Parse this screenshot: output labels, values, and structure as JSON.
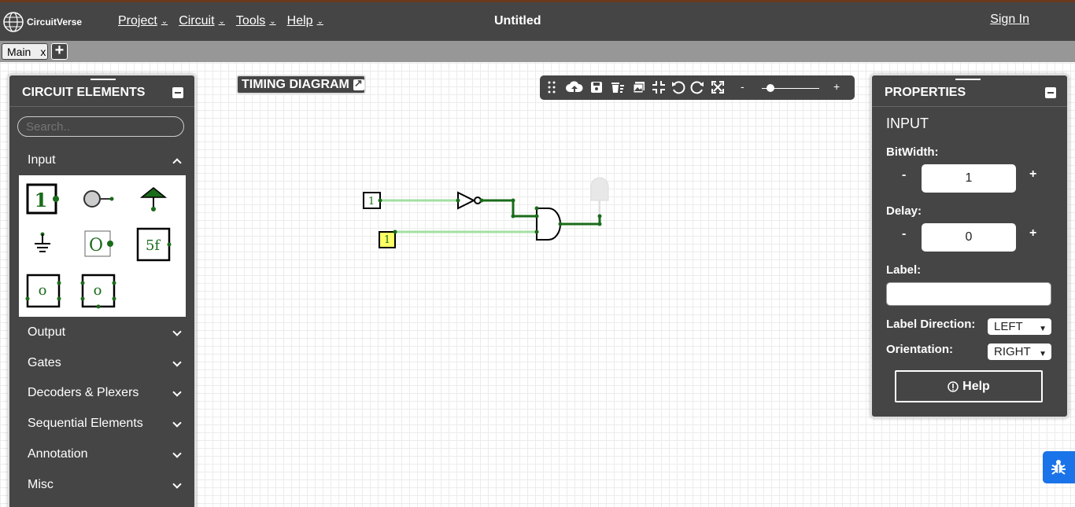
{
  "app": {
    "logo_name": "CircuitVerse",
    "title": "Untitled",
    "sign_in": "Sign In"
  },
  "nav": {
    "items": [
      "Project",
      "Circuit",
      "Tools",
      "Help"
    ]
  },
  "tabs": {
    "main_label": "Main",
    "close": "x",
    "add": "+"
  },
  "elements_panel": {
    "title": "CIRCUIT ELEMENTS",
    "search_placeholder": "Search..",
    "categories": [
      "Input",
      "Output",
      "Gates",
      "Decoders & Plexers",
      "Sequential Elements",
      "Annotation",
      "Misc"
    ],
    "input_icons": [
      "input-icon",
      "button-icon",
      "power-icon",
      "ground-icon",
      "constant-val-icon",
      "stepper-icon",
      "random-icon",
      "counter-icon"
    ],
    "icon_text": {
      "input": "1",
      "constant": "O",
      "stepper": "5f",
      "random": "o",
      "counter": "o"
    }
  },
  "timing_diagram": {
    "label": "TIMING DIAGRAM"
  },
  "toolbar": {
    "icons": [
      "drag-handle-icon",
      "upload-icon",
      "save-icon",
      "delete-icon",
      "image-icon",
      "fit-icon",
      "undo-icon",
      "redo-icon",
      "fullscreen-icon"
    ],
    "zoom_out": "-",
    "zoom_in": "+",
    "zoom_level": 0.1
  },
  "properties": {
    "title": "PROPERTIES",
    "element": "INPUT",
    "bitwidth_label": "BitWidth:",
    "bitwidth_value": "1",
    "delay_label": "Delay:",
    "delay_value": "0",
    "label_label": "Label:",
    "label_value": "",
    "label_direction_label": "Label Direction:",
    "label_direction_value": "LEFT",
    "orientation_label": "Orientation:",
    "orientation_value": "RIGHT",
    "minus": "-",
    "plus": "+",
    "help": "Help"
  },
  "circuit": {
    "input_a": "1",
    "input_b": "1"
  },
  "colors": {
    "panel_bg": "#454545",
    "wire_active": "#1a6b1a",
    "wire_light": "#a3e0a3",
    "selected_fill": "#ffff66",
    "bug_button": "#1a73e8"
  }
}
